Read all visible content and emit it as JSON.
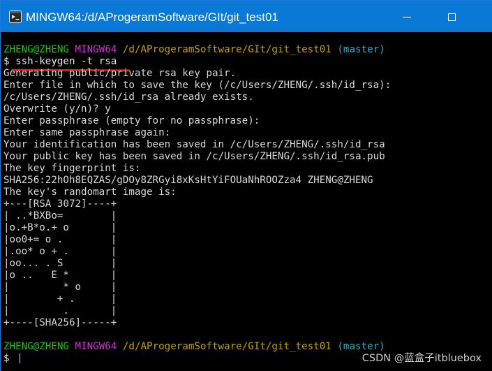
{
  "window": {
    "title": "MINGW64:/d/AProgeramSoftware/GIt/git_test01",
    "icon": "git-bash-icon",
    "controls": [
      "minimize-icon",
      "maximize-icon"
    ]
  },
  "prompt1": {
    "user": "ZHENG@ZHENG",
    "env": "MINGW64",
    "path": "/d/AProgeramSoftware/GIt/git_test01",
    "branch": "(master)"
  },
  "command": {
    "prefix": "$ ",
    "text": "ssh-keygen -t rsa"
  },
  "output": [
    "Generating public/private rsa key pair.",
    "Enter file in which to save the key (/c/Users/ZHENG/.ssh/id_rsa):",
    "/c/Users/ZHENG/.ssh/id_rsa already exists.",
    "Overwrite (y/n)? y",
    "Enter passphrase (empty for no passphrase):",
    "Enter same passphrase again:",
    "Your identification has been saved in /c/Users/ZHENG/.ssh/id_rsa",
    "Your public key has been saved in /c/Users/ZHENG/.ssh/id_rsa.pub",
    "The key fingerprint is:",
    "SHA256:22hOh8EQZAS/gDOy8ZRGyi8xKsHtYiFOUaNhROOZza4 ZHENG@ZHENG",
    "The key's randomart image is:",
    "+---[RSA 3072]----+",
    "| ..*BXBo=        |",
    "|o.+B*o.+ o       |",
    "|oo0+= o .        |",
    "|.oo* o + .       |",
    "|oo... . S        |",
    "|o ..   E *       |",
    "|         * o     |",
    "|        + .      |",
    "|         .       |",
    "+----[SHA256]-----+"
  ],
  "prompt2": {
    "user": "ZHENG@ZHENG",
    "env": "MINGW64",
    "path": "/d/AProgeramSoftware/GIt/git_test01",
    "branch": "(master)"
  },
  "input_line": {
    "prefix": "$ "
  },
  "annotation": {
    "color": "#e01b1b"
  },
  "watermark": "CSDN @蓝盒子itbluebox",
  "colors": {
    "titlebar": "#0a78d7",
    "terminal_bg": "#000000",
    "user": "#16c60c",
    "env": "#c239c8",
    "path": "#c4a000",
    "branch": "#23b1cf",
    "text": "#d8d8d8"
  }
}
